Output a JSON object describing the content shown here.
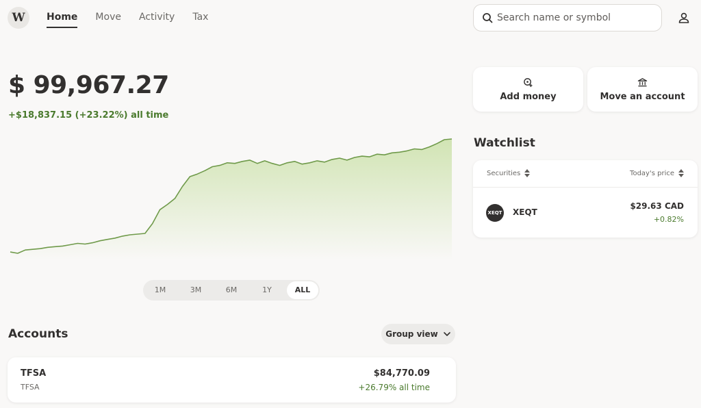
{
  "brand": {
    "logo_letter": "W"
  },
  "nav": {
    "items": [
      "Home",
      "Move",
      "Activity",
      "Tax"
    ],
    "active": "Home"
  },
  "search": {
    "placeholder": "Search name or symbol"
  },
  "portfolio": {
    "balance": "$ 99,967.27",
    "change": "+$18,837.15 (+23.22%) all time"
  },
  "time_ranges": {
    "items": [
      "1M",
      "3M",
      "6M",
      "1Y",
      "ALL"
    ],
    "selected": "ALL"
  },
  "accounts": {
    "title": "Accounts",
    "group_view_label": "Group view",
    "items": [
      {
        "name": "TFSA",
        "type": "TFSA",
        "value": "$84,770.09",
        "return": "+26.79% all time"
      }
    ]
  },
  "actions": {
    "add_money": "Add money",
    "move_account": "Move an account"
  },
  "watchlist": {
    "title": "Watchlist",
    "col_securities": "Securities",
    "col_price": "Today's price",
    "items": [
      {
        "badge": "XEQT",
        "symbol": "XEQT",
        "price": "$29.63 CAD",
        "change": "+0.82%"
      }
    ]
  },
  "colors": {
    "positive": "#4a7a2d",
    "chart_line": "#6f9a4a",
    "chart_fill": "#cfe3b0",
    "text": "#32302f"
  },
  "chart_data": {
    "type": "area",
    "series": [
      {
        "values": [
          80000,
          79800,
          80300,
          80400,
          80500,
          80700,
          80800,
          80900,
          81100,
          81300,
          81200,
          81400,
          81700,
          81900,
          82100,
          82400,
          82600,
          82700,
          82800,
          84300,
          86400,
          87200,
          88100,
          89900,
          91400,
          91800,
          92300,
          92900,
          93100,
          93500,
          93400,
          93700,
          93900,
          93400,
          93800,
          93400,
          93100,
          93500,
          93700,
          93300,
          93500,
          93800,
          93600,
          94000,
          94200,
          93900,
          94300,
          94500,
          94400,
          94800,
          94700,
          95000,
          95100,
          95300,
          95600,
          95500,
          95900,
          96400,
          97000,
          97100
        ]
      }
    ]
  },
  "icons": {
    "search": "search-icon",
    "profile": "user-icon",
    "add_money": "plus-coin-icon",
    "move_account": "bank-icon",
    "chevron": "chevron-down-icon",
    "sort": "sort-icon"
  }
}
